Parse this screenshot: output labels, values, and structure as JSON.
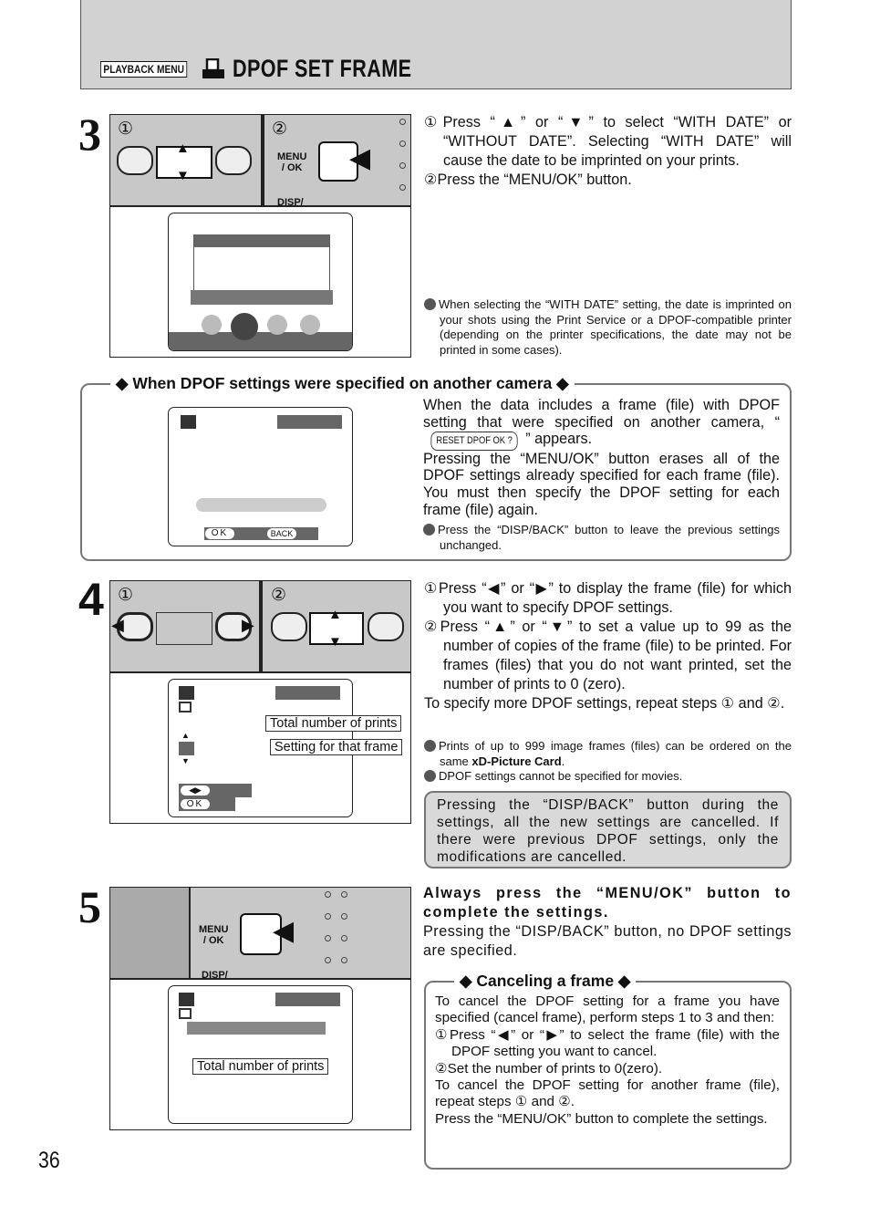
{
  "header": {
    "menu_badge": "PLAYBACK MENU",
    "title": "DPOF SET FRAME",
    "icon": "print-icon"
  },
  "page_number": "36",
  "step3": {
    "number": "3",
    "fig": {
      "c1": "①",
      "c2": "②",
      "menu_ok": "MENU\n/ OK",
      "disp": "DISP/"
    },
    "lines": [
      "①Press “▲” or “▼” to select “WITH DATE” or “WITHOUT DATE”. Selecting “WITH DATE” will cause the date to be imprinted on your prints.",
      "②Press the “MENU/OK” button."
    ],
    "note": "When selecting the “WITH DATE” setting, the date is imprinted on your shots using the Print Service or a DPOF-compatible printer (depending on the printer specifications, the date may not be printed in some cases)."
  },
  "other_camera": {
    "title": "◆ When DPOF settings were specified on another camera ◆",
    "text1_a": "When the data includes a frame (file) with DPOF setting that were specified on another camera, “",
    "reset_label": "RESET DPOF OK ?",
    "text1_b": "” appears.",
    "text2": "Pressing the “MENU/OK” button erases all of the DPOF settings already specified for each frame (file). You must then specify the DPOF setting for each frame (file) again.",
    "note": "Press the “DISP/BACK” button to leave the previous settings unchanged.",
    "ok": "OK",
    "back": "BACK"
  },
  "step4": {
    "number": "4",
    "c1": "①",
    "c2": "②",
    "callout1": "Total number of prints",
    "callout2": "Setting for that frame",
    "ok": "OK",
    "lines": [
      "①Press “◀” or “▶” to display the frame (file) for which you want to specify DPOF settings.",
      "②Press “▲” or “▼” to set a value up to 99 as the number of copies of the frame (file) to be printed. For frames (files) that you do not want printed, set the number of prints to 0 (zero).",
      "To specify more DPOF settings, repeat steps ① and ②."
    ],
    "note1_a": "Prints of up to 999 image frames (files) can be ordered on the same ",
    "note1_b": "xD-Picture Card",
    "note1_c": ".",
    "note2": "DPOF settings cannot be specified for movies.",
    "warning": "Pressing the “DISP/BACK” button during the settings, all the new settings are cancelled. If there were previous DPOF settings, only the modifications are cancelled."
  },
  "step5": {
    "number": "5",
    "menu_ok": "MENU\n/ OK",
    "disp": "DISP/",
    "callout": "Total number of prints",
    "bold": "Always press the “MENU/OK” button to complete the settings.",
    "text": "Pressing the “DISP/BACK” button, no DPOF settings are specified."
  },
  "cancel": {
    "title": "◆ Canceling a frame ◆",
    "lines": [
      "To cancel the DPOF setting for a frame you have specified (cancel frame), perform steps 1 to 3 and then:",
      "①Press “◀” or “▶” to select the frame (file) with the DPOF setting you want to cancel.",
      "②Set the number of prints to 0(zero).",
      "To cancel the DPOF setting for another frame (file), repeat steps ① and ②.",
      "Press the “MENU/OK” button to complete the settings."
    ]
  }
}
